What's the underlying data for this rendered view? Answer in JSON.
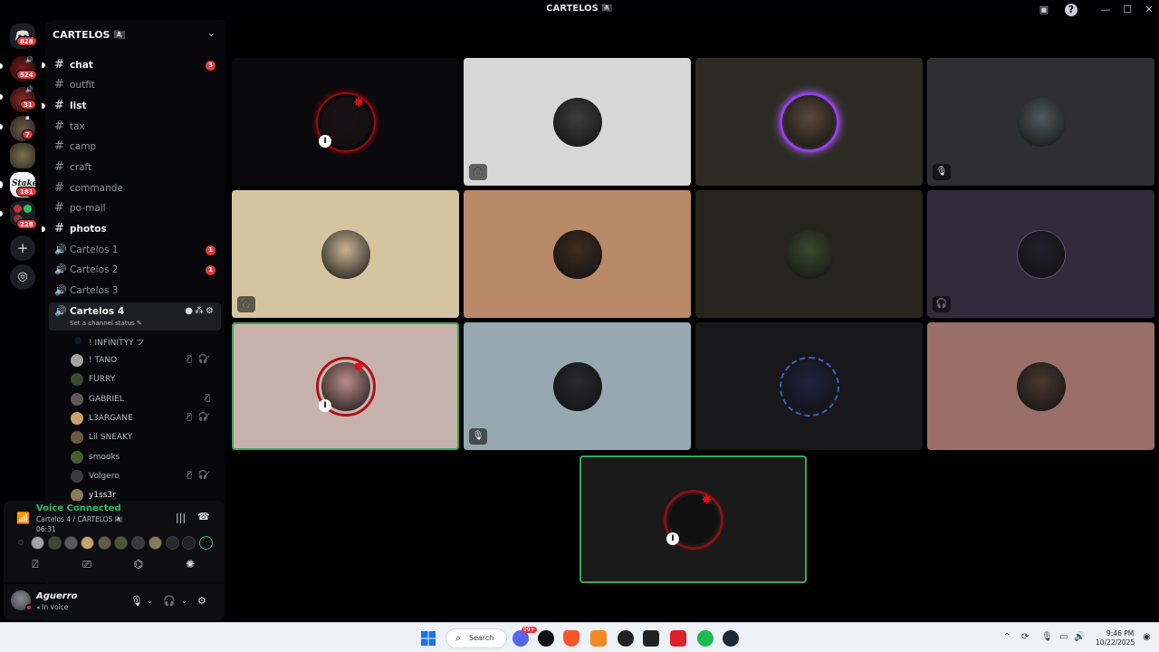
{
  "window": {
    "title": "CARTELOS 🏴‍☠️"
  },
  "servers": [
    {
      "name": "discord-home",
      "badge": "828"
    },
    {
      "name": "server-1",
      "badge": "524"
    },
    {
      "name": "server-2",
      "badge": "31"
    },
    {
      "name": "server-3",
      "badge": "7"
    },
    {
      "name": "server-4",
      "badge": ""
    },
    {
      "name": "server-stake",
      "badge": "181"
    },
    {
      "name": "server-folder",
      "badge": "228"
    }
  ],
  "server_header": "CARTELOS 🏴‍☠️",
  "channels": [
    {
      "name": "chat",
      "type": "text",
      "unread": true,
      "mentions": "3"
    },
    {
      "name": "outfit",
      "type": "text",
      "unread": false,
      "mentions": ""
    },
    {
      "name": "list",
      "type": "text",
      "unread": true,
      "mentions": ""
    },
    {
      "name": "tax",
      "type": "text",
      "unread": false,
      "mentions": ""
    },
    {
      "name": "camp",
      "type": "text",
      "unread": false,
      "mentions": ""
    },
    {
      "name": "craft",
      "type": "text",
      "unread": false,
      "mentions": ""
    },
    {
      "name": "commande",
      "type": "text",
      "unread": false,
      "mentions": ""
    },
    {
      "name": "po-mail",
      "type": "text",
      "unread": false,
      "mentions": ""
    },
    {
      "name": "photos",
      "type": "text",
      "unread": true,
      "mentions": ""
    },
    {
      "name": "Cartelos 1",
      "type": "voice",
      "unread": false,
      "mentions": "1"
    },
    {
      "name": "Cartelos 2",
      "type": "voice",
      "unread": false,
      "mentions": "1"
    },
    {
      "name": "Cartelos 3",
      "type": "voice",
      "unread": false,
      "mentions": ""
    }
  ],
  "active_channel": {
    "name": "Cartelos 4",
    "status_placeholder": "Set a channel status"
  },
  "voice_members": [
    {
      "name": "! INFINITYY ツ",
      "icons": ""
    },
    {
      "name": "! TANO",
      "icons": "🎙̸ 🎧̸"
    },
    {
      "name": "FURRY",
      "icons": ""
    },
    {
      "name": "GABRIEL",
      "icons": "🎙̸"
    },
    {
      "name": "L3ARGANE",
      "icons": "🎙̸ 🎧̸"
    },
    {
      "name": "Lil SNEAKY",
      "icons": ""
    },
    {
      "name": "smooks",
      "icons": ""
    },
    {
      "name": "Volgero",
      "icons": "🎙̸ 🎧̸"
    },
    {
      "name": "y1ss3r",
      "icons": ""
    }
  ],
  "voice_panel": {
    "title": "Voice Connected",
    "location": "Cartelos 4 / CARTELOS 🏴‍☠️",
    "elapsed": "06:31"
  },
  "user": {
    "name": "Aguerro",
    "status": "In voice"
  },
  "tiles": [
    {
      "bg": "#0a0a0d",
      "av": "#1b0f14",
      "mute": "",
      "speaking": false
    },
    {
      "bg": "#d7d7d7",
      "av": "#3d3d3d",
      "mute": "deafened",
      "speaking": false
    },
    {
      "bg": "#2b2b23",
      "av": "#5a4a3a",
      "mute": "",
      "speaking": false
    },
    {
      "bg": "#2f2f33",
      "av": "#4f5a5e",
      "mute": "muted",
      "speaking": false
    },
    {
      "bg": "#d5c4a0",
      "av": "#c9b493",
      "mute": "deafened",
      "speaking": false
    },
    {
      "bg": "#b98a67",
      "av": "#3e2c21",
      "mute": "",
      "speaking": false
    },
    {
      "bg": "#25251d",
      "av": "#3a4a30",
      "mute": "",
      "speaking": false
    },
    {
      "bg": "#302c3c",
      "av": "#221f2d",
      "mute": "deafened",
      "speaking": false
    },
    {
      "bg": "#c8b3ac",
      "av": "#b98d88",
      "mute": "",
      "speaking": true
    },
    {
      "bg": "#97a9b0",
      "av": "#2a2a2e",
      "mute": "muted",
      "speaking": false
    },
    {
      "bg": "#18181b",
      "av": "#1f2440",
      "mute": "",
      "speaking": false
    },
    {
      "bg": "#9a6f68",
      "av": "#4a3830",
      "mute": "",
      "speaking": false
    },
    {
      "bg": "#1a1a1a",
      "av": "#101010",
      "mute": "",
      "speaking": true
    }
  ],
  "taskbar": {
    "search_label": "Search",
    "time": "9:46 PM",
    "date": "10/22/2025",
    "chat_badge": "99+"
  },
  "colors": {
    "accent_green": "#2cbf64",
    "speaking_outline": "#3ba55d",
    "mention_red": "#e03a3e"
  }
}
